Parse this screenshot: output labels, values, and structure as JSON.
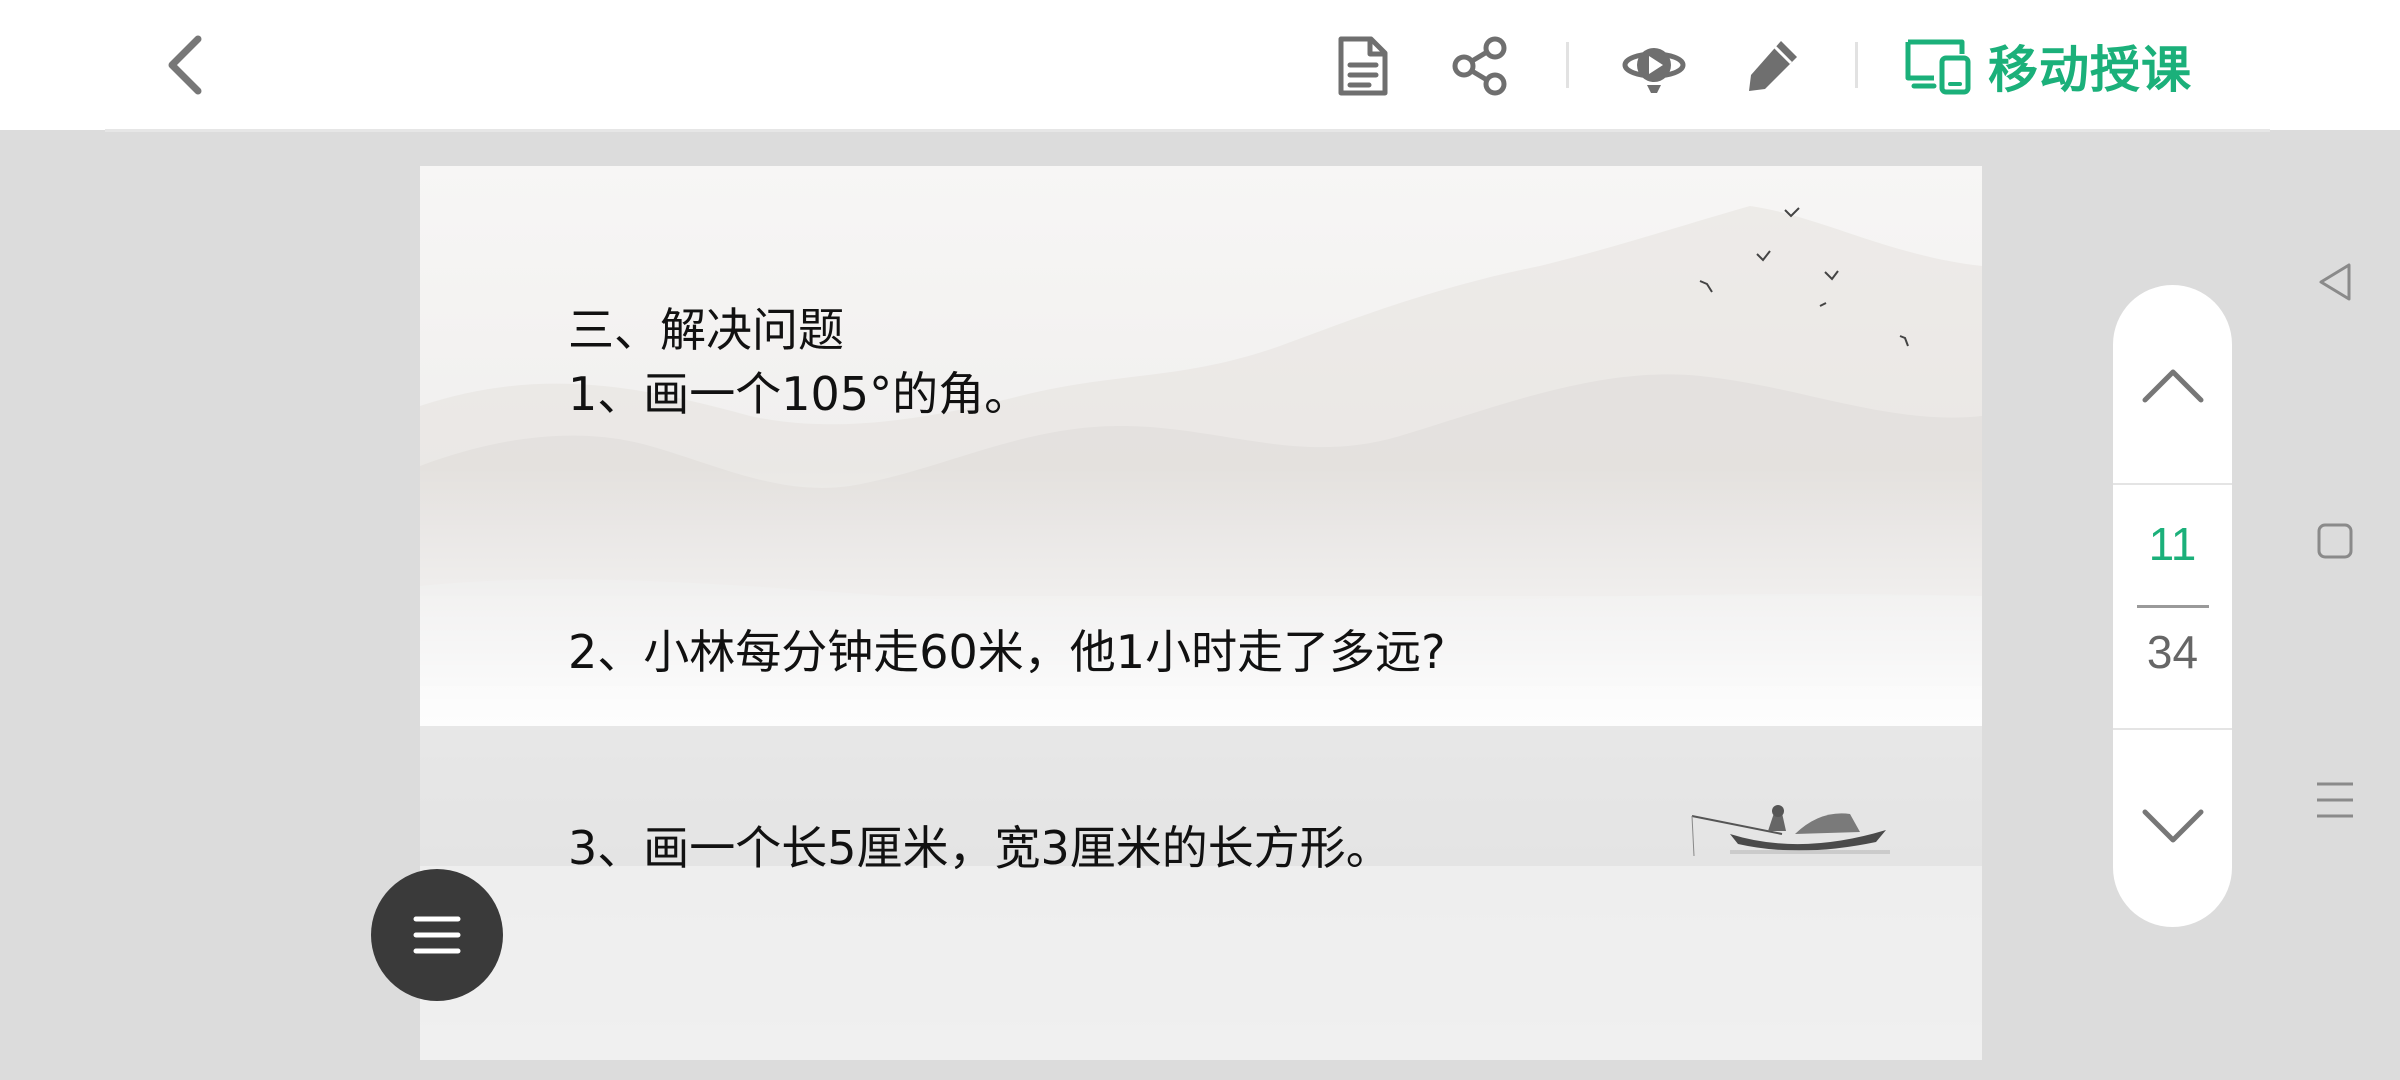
{
  "toolbar": {
    "cast_label": "移动授课",
    "accent_color": "#1bb07a",
    "icons": [
      "back-arrow-icon",
      "notes-icon",
      "share-icon",
      "planet-play-icon",
      "pen-icon",
      "cast-device-icon"
    ]
  },
  "slide": {
    "heading": "三、解决问题",
    "q1": "1、画一个105°的角。",
    "q2": "2、小林每分钟走60米，他1小时走了多远?",
    "q3": "3、画一个长5厘米，宽3厘米的长方形。"
  },
  "pager": {
    "current": "11",
    "total": "34"
  },
  "fab": {
    "icon": "menu-icon"
  },
  "system_nav": {
    "icons": [
      "back-triangle-icon",
      "home-square-icon",
      "menu-lines-icon"
    ]
  }
}
